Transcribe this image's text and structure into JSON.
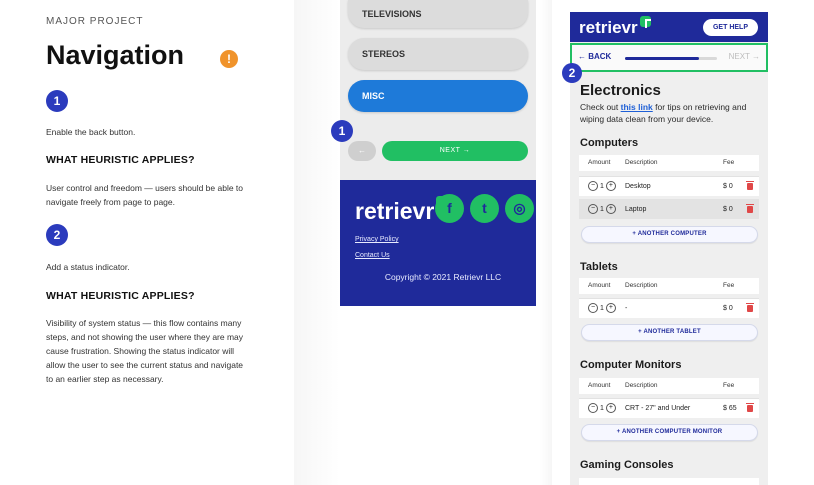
{
  "left": {
    "kicker": "MAJOR PROJECT",
    "title": "Navigation",
    "warning_glyph": "!",
    "step1": {
      "badge": "1",
      "description": "Enable the back button.",
      "heading": "WHAT HEURISTIC APPLIES?",
      "text": "User control and freedom — users should be able to navigate freely from page to page."
    },
    "step2": {
      "badge": "2",
      "description": "Add a status indicator.",
      "heading": "WHAT HEURISTIC APPLIES?",
      "text": "Visibility of system status — this flow contains many steps, and not showing the user where they are may cause frustration. Showing the status indicator will allow the user to see the current status and navigate to an earlier step as necessary."
    }
  },
  "phone1": {
    "options": [
      "TELEVISIONS",
      "STEREOS",
      "MISC"
    ],
    "active_option": "MISC",
    "back_glyph": "←",
    "next_label": "NEXT   →",
    "annotation_badge": "1",
    "footer": {
      "logo": "retrievr",
      "social_icons": [
        "facebook-icon",
        "twitter-icon",
        "instagram-icon"
      ],
      "privacy": "Privacy Policy",
      "contact": "Contact Us",
      "copyright": "Copyright © 2021 Retrievr LLC"
    }
  },
  "phone2": {
    "logo": "retrievr",
    "help": "GET HELP",
    "back": "← BACK",
    "next": "NEXT →",
    "progress": 0.8,
    "annotation_badge": "2",
    "heading": "Electronics",
    "intro_before": "Check out ",
    "intro_link": "this link",
    "intro_after": " for tips on retrieving and wiping data clean from your device.",
    "table_headers": [
      "Amount",
      "Description",
      "Fee"
    ],
    "sections": [
      {
        "title": "Computers",
        "rows": [
          {
            "qty": "1",
            "desc": "Desktop",
            "fee": "$ 0"
          },
          {
            "qty": "1",
            "desc": "Laptop",
            "fee": "$ 0"
          }
        ],
        "add": "+ ANOTHER COMPUTER"
      },
      {
        "title": "Tablets",
        "rows": [
          {
            "qty": "1",
            "desc": "-",
            "fee": "$ 0"
          }
        ],
        "add": "+ ANOTHER TABLET"
      },
      {
        "title": "Computer Monitors",
        "rows": [
          {
            "qty": "1",
            "desc": "CRT - 27\" and Under",
            "fee": "$ 65"
          }
        ],
        "add": "+ ANOTHER COMPUTER MONITOR"
      },
      {
        "title": "Gaming Consoles",
        "rows": [],
        "add": ""
      }
    ]
  },
  "colors": {
    "brand_navy": "#1f2a9a",
    "brand_green": "#21bf63",
    "active_blue": "#1e7ad9",
    "warning_orange": "#f0932b",
    "badge_blue": "#2b3bbd"
  }
}
